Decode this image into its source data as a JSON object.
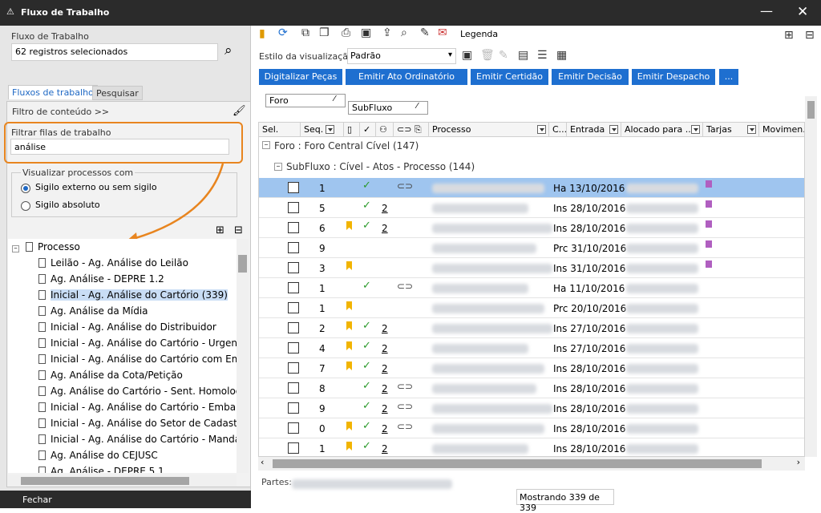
{
  "window": {
    "title": "Fluxo de Trabalho",
    "logo_glyph": "⚠",
    "minimize_glyph": "—",
    "close_glyph": "✕"
  },
  "left": {
    "workflow_label": "Fluxo de Trabalho",
    "workflow_value": "62 registros selecionados",
    "search_glyph": "⌕",
    "tabs": [
      "Fluxos de trabalho",
      "Pesquisar"
    ],
    "content_filter": "Filtro de conteúdo >>",
    "brush_glyph": "🖌",
    "queue_filter_label": "Filtrar filas de trabalho",
    "queue_filter_value": "análise",
    "visualize_label": "Visualizar processos com",
    "radio1": "Sigilo externo ou sem sigilo",
    "radio2": "Sigilo absoluto",
    "tree_root": "Processo",
    "tree_items": [
      "Leilão - Ag. Análise do Leilão",
      "Ag. Análise - DEPRE 1.2",
      "Inicial - Ag. Análise do Cartório (339)",
      "Ag. Análise da Mídia",
      "Inicial  - Ag. Análise do Distribuidor",
      "Inicial - Ag. Análise do Cartório - Urgente (",
      "Inicial - Ag. Análise do Cartório com Emenc",
      "Ag. Análise da Cota/Petição",
      "Ag. Análise do Cartório - Sent. Homolog. A",
      "Inicial - Ag. Análise do Cartório - Embargos",
      "Inicial - Ag. Análise do Setor de Cadastro",
      "Inicial - Ag. Análise do Cartório - Mandado",
      "Ag. Análise do CEJUSC",
      "Ag. Análise - DEPRE 5.1"
    ],
    "close_label": "Fechar"
  },
  "toolbar": {
    "legend_label": "Legenda",
    "view_style_label": "Estilo da visualização",
    "view_style_value": "Padrão",
    "buttons": [
      "Digitalizar Peças",
      "Emitir Ato Ordinatório",
      "Emitir Certidão",
      "Emitir Decisão",
      "Emitir Despacho",
      "..."
    ],
    "group_chips": [
      "Foro",
      "SubFluxo"
    ]
  },
  "grid": {
    "headers": [
      "Sel.",
      "Seq.",
      "",
      "",
      "",
      "",
      "Processo",
      "C...",
      "Entrada",
      "Alocado para ...",
      "Tarjas",
      "Movimen..."
    ],
    "group1": "Foro : Foro Central Cível  (147)",
    "group2": "SubFluxo : Cível - Atos - Processo  (144)",
    "rows": [
      {
        "seq": "1",
        "flag": false,
        "check": true,
        "count": "",
        "link": true,
        "entry": "Ha 13/10/2016",
        "tarja": true,
        "selected": true
      },
      {
        "seq": "5",
        "flag": false,
        "check": true,
        "count": "2",
        "link": false,
        "entry": "Ins 28/10/2016",
        "tarja": true,
        "selected": false
      },
      {
        "seq": "6",
        "flag": true,
        "check": true,
        "count": "2",
        "link": false,
        "entry": "Ins 28/10/2016",
        "tarja": true,
        "selected": false
      },
      {
        "seq": "9",
        "flag": false,
        "check": false,
        "count": "",
        "link": false,
        "entry": "Prc 31/10/2016",
        "tarja": true,
        "selected": false
      },
      {
        "seq": "3",
        "flag": true,
        "check": false,
        "count": "",
        "link": false,
        "entry": "Ins 31/10/2016",
        "tarja": true,
        "selected": false
      },
      {
        "seq": "1",
        "flag": false,
        "check": true,
        "count": "",
        "link": true,
        "entry": "Ha 11/10/2016",
        "tarja": false,
        "selected": false
      },
      {
        "seq": "1",
        "flag": true,
        "check": false,
        "count": "",
        "link": false,
        "entry": "Prc 20/10/2016",
        "tarja": false,
        "selected": false
      },
      {
        "seq": "2",
        "flag": true,
        "check": true,
        "count": "2",
        "link": false,
        "entry": "Ins 27/10/2016",
        "tarja": false,
        "selected": false
      },
      {
        "seq": "4",
        "flag": true,
        "check": true,
        "count": "2",
        "link": false,
        "entry": "Ins 27/10/2016",
        "tarja": false,
        "selected": false
      },
      {
        "seq": "7",
        "flag": true,
        "check": true,
        "count": "2",
        "link": false,
        "entry": "Ins 28/10/2016",
        "tarja": false,
        "selected": false
      },
      {
        "seq": "8",
        "flag": false,
        "check": true,
        "count": "2",
        "link": true,
        "entry": "Ins 28/10/2016",
        "tarja": false,
        "selected": false
      },
      {
        "seq": "9",
        "flag": false,
        "check": true,
        "count": "2",
        "link": true,
        "entry": "Ins 28/10/2016",
        "tarja": false,
        "selected": false
      },
      {
        "seq": "0",
        "flag": true,
        "check": true,
        "count": "2",
        "link": true,
        "entry": "Ins 28/10/2016",
        "tarja": false,
        "selected": false
      },
      {
        "seq": "1",
        "flag": true,
        "check": true,
        "count": "2",
        "link": false,
        "entry": "Ins 28/10/2016",
        "tarja": false,
        "selected": false
      }
    ]
  },
  "footer": {
    "parts_label": "Partes:",
    "showing": "Mostrando 339 de 339"
  },
  "colors": {
    "accent": "#1e6fd0",
    "highlight": "#e8851f",
    "tarja": "#b05fc0"
  }
}
